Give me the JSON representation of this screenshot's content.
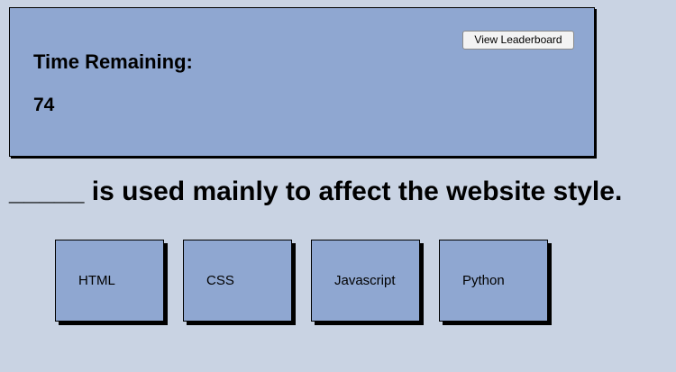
{
  "timer": {
    "leaderboard_label": "View Leaderboard",
    "label": "Time Remaining:",
    "value": "74"
  },
  "question": {
    "text": "_____ is used mainly to affect the website style."
  },
  "choices": [
    {
      "label": "HTML"
    },
    {
      "label": "CSS"
    },
    {
      "label": "Javascript"
    },
    {
      "label": "Python"
    }
  ],
  "colors": {
    "background": "#c9d3e3",
    "panel": "#8fa7d1",
    "shadow": "#000000"
  }
}
